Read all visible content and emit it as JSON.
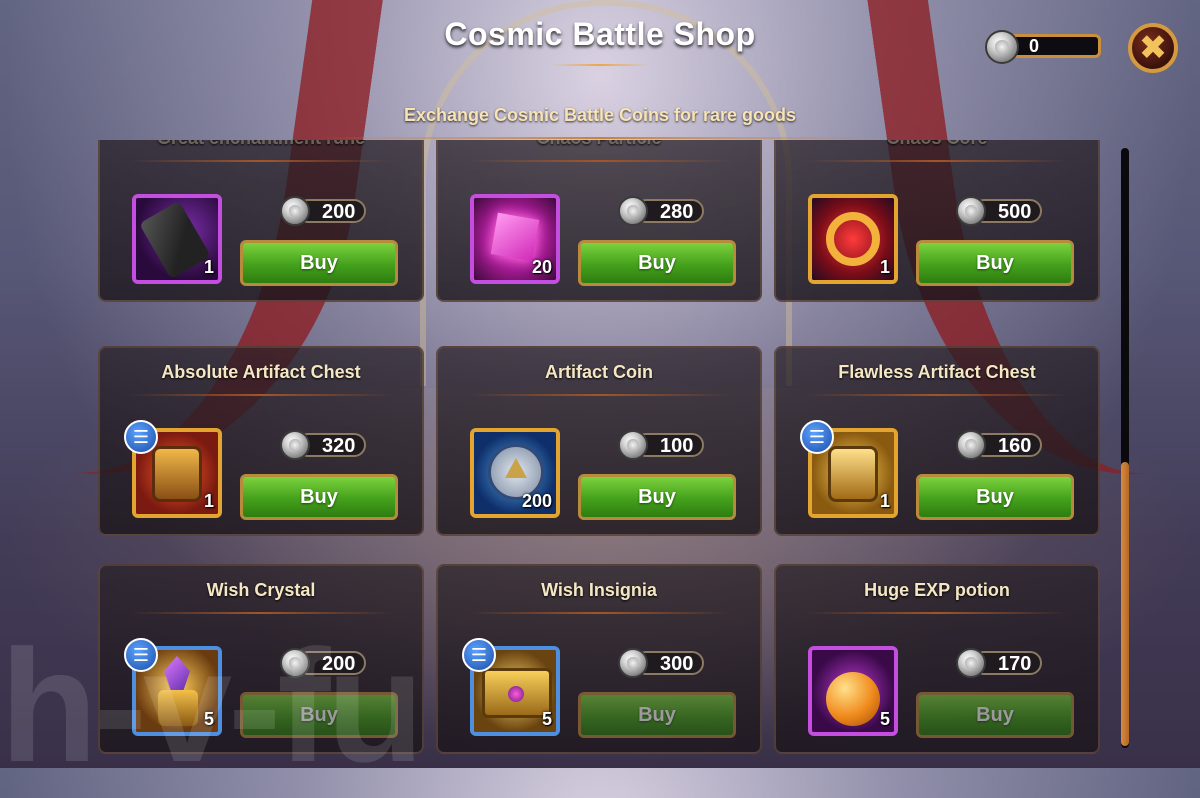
{
  "header": {
    "title": "Cosmic Battle Shop",
    "subtitle": "Exchange Cosmic Battle Coins for rare goods",
    "coin_balance": "0",
    "close_icon": "✖"
  },
  "watermark": "h-v-fu",
  "items": [
    {
      "name": "Great enchantment rune",
      "price": "200",
      "qty": "1",
      "buy": "Buy",
      "frame": "purple",
      "art": "rune",
      "info": false
    },
    {
      "name": "Chaos Particle",
      "price": "280",
      "qty": "20",
      "buy": "Buy",
      "frame": "purple",
      "art": "particle",
      "info": false
    },
    {
      "name": "Chaos Core",
      "price": "500",
      "qty": "1",
      "buy": "Buy",
      "frame": "gold",
      "art": "core",
      "info": false
    },
    {
      "name": "Absolute Artifact Chest",
      "price": "320",
      "qty": "1",
      "buy": "Buy",
      "frame": "gold",
      "art": "chest",
      "info": true
    },
    {
      "name": "Artifact Coin",
      "price": "100",
      "qty": "200",
      "buy": "Buy",
      "frame": "gold",
      "art": "coin",
      "info": false
    },
    {
      "name": "Flawless Artifact Chest",
      "price": "160",
      "qty": "1",
      "buy": "Buy",
      "frame": "gold",
      "art": "chest-gold",
      "info": true
    },
    {
      "name": "Wish Crystal",
      "price": "200",
      "qty": "5",
      "buy": "Buy",
      "frame": "blue",
      "art": "crystal",
      "info": true
    },
    {
      "name": "Wish Insignia",
      "price": "300",
      "qty": "5",
      "buy": "Buy",
      "frame": "blue",
      "art": "insignia",
      "info": true
    },
    {
      "name": "Huge EXP potion",
      "price": "170",
      "qty": "5",
      "buy": "Buy",
      "frame": "purple",
      "art": "potion",
      "info": false
    }
  ],
  "info_icon": "☰",
  "colors": {
    "buy_green": "#44a11c",
    "accent_gold": "#d59a3e",
    "info_blue": "#1d4ea8"
  }
}
